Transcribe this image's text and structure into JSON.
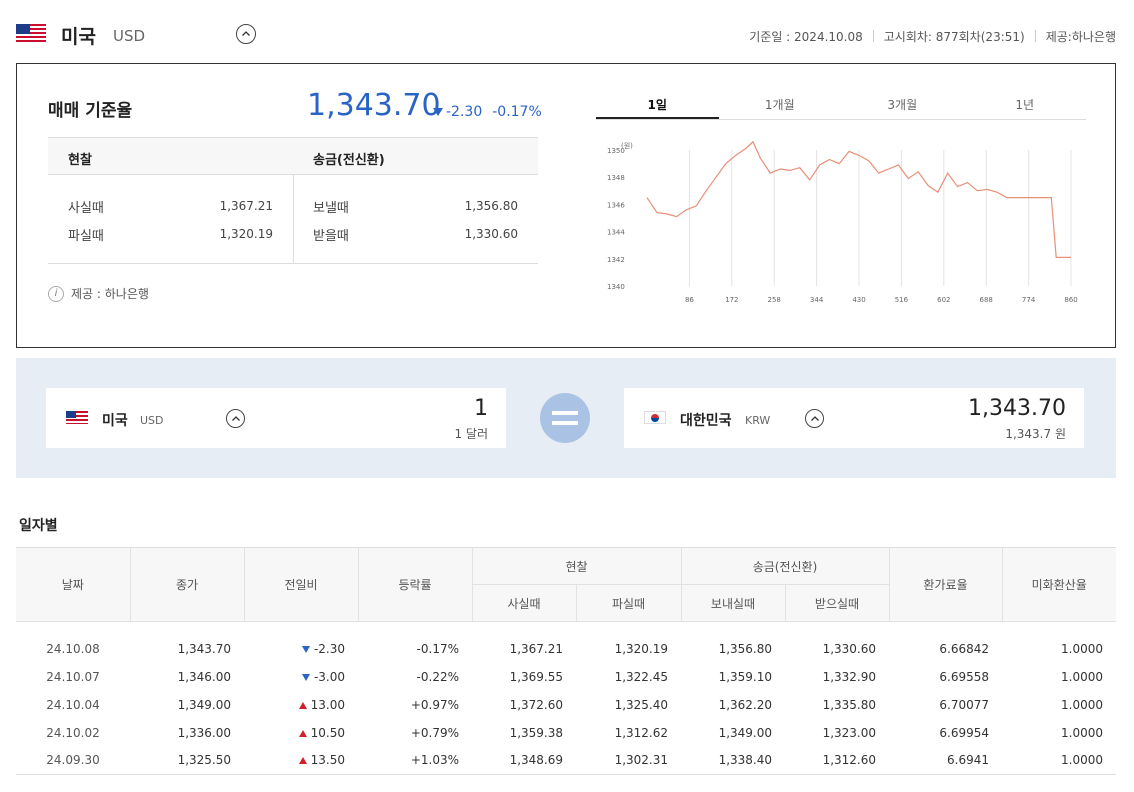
{
  "header": {
    "country": "미국",
    "code": "USD",
    "base_date": "기준일 : 2024.10.08",
    "notice": "고시회차: 877회차(23:51)",
    "provider": "제공:하나은행"
  },
  "summary": {
    "label": "매매 기준율",
    "rate": "1,343.70",
    "change": "-2.30",
    "change_pct": "-0.17%",
    "cash_header": "현찰",
    "wire_header": "송금(전신환)",
    "cash_buy_label": "사실때",
    "cash_buy": "1,367.21",
    "cash_sell_label": "파실때",
    "cash_sell": "1,320.19",
    "wire_send_label": "보낼때",
    "wire_send": "1,356.80",
    "wire_recv_label": "받을때",
    "wire_recv": "1,330.60",
    "provider_note": "제공 : 하나은행"
  },
  "tabs": [
    "1일",
    "1개월",
    "3개월",
    "1년"
  ],
  "chart_data": {
    "type": "line",
    "unit_label": "(원)",
    "x_ticks": [
      86,
      172,
      258,
      344,
      430,
      516,
      602,
      688,
      774,
      860
    ],
    "y_ticks": [
      1340,
      1342,
      1344,
      1346,
      1348,
      1350
    ],
    "xlim": [
      0,
      860
    ],
    "ylim": [
      1340,
      1350
    ],
    "grid": "vertical",
    "color": "#e88f78",
    "series": [
      {
        "x": [
          0,
          20,
          40,
          60,
          80,
          100,
          120,
          140,
          160,
          180,
          200,
          215,
          230,
          250,
          270,
          290,
          310,
          330,
          350,
          370,
          390,
          410,
          430,
          450,
          470,
          490,
          510,
          530,
          550,
          570,
          590,
          610,
          630,
          650,
          670,
          690,
          710,
          730,
          750,
          770,
          780,
          800,
          820,
          830,
          840,
          860
        ],
        "y": [
          1346.5,
          1345.4,
          1345.3,
          1345.1,
          1345.6,
          1345.9,
          1347.0,
          1348.0,
          1349.0,
          1349.6,
          1350.1,
          1350.6,
          1349.4,
          1348.3,
          1348.6,
          1348.5,
          1348.7,
          1347.8,
          1348.9,
          1349.3,
          1349.0,
          1349.9,
          1349.6,
          1349.2,
          1348.3,
          1348.6,
          1348.9,
          1347.9,
          1348.4,
          1347.4,
          1346.9,
          1348.3,
          1347.3,
          1347.6,
          1347.0,
          1347.1,
          1346.9,
          1346.5,
          1346.5,
          1346.5,
          1346.5,
          1346.5,
          1346.5,
          1342.1,
          1342.1,
          1342.1
        ]
      }
    ]
  },
  "converter": {
    "from_country": "미국",
    "from_code": "USD",
    "from_amount": "1",
    "from_sub": "1 달러",
    "to_country": "대한민국",
    "to_code": "KRW",
    "to_amount": "1,343.70",
    "to_sub": "1,343.7 원"
  },
  "daily": {
    "title": "일자별",
    "headers": {
      "date": "날짜",
      "close": "종가",
      "diff": "전일비",
      "pct": "등락률",
      "cash": "현찰",
      "cash_buy": "사실때",
      "cash_sell": "파실때",
      "wire": "송금(전신환)",
      "wire_send": "보내실때",
      "wire_recv": "받으실때",
      "fee": "환가료율",
      "usd_rate": "미화환산율"
    },
    "rows": [
      {
        "date": "24.10.08",
        "close": "1,343.70",
        "dir": "down",
        "diff": "-2.30",
        "pct": "-0.17%",
        "cash_buy": "1,367.21",
        "cash_sell": "1,320.19",
        "wire_send": "1,356.80",
        "wire_recv": "1,330.60",
        "fee": "6.66842",
        "usd_rate": "1.0000"
      },
      {
        "date": "24.10.07",
        "close": "1,346.00",
        "dir": "down",
        "diff": "-3.00",
        "pct": "-0.22%",
        "cash_buy": "1,369.55",
        "cash_sell": "1,322.45",
        "wire_send": "1,359.10",
        "wire_recv": "1,332.90",
        "fee": "6.69558",
        "usd_rate": "1.0000"
      },
      {
        "date": "24.10.04",
        "close": "1,349.00",
        "dir": "up",
        "diff": "13.00",
        "pct": "+0.97%",
        "cash_buy": "1,372.60",
        "cash_sell": "1,325.40",
        "wire_send": "1,362.20",
        "wire_recv": "1,335.80",
        "fee": "6.70077",
        "usd_rate": "1.0000"
      },
      {
        "date": "24.10.02",
        "close": "1,336.00",
        "dir": "up",
        "diff": "10.50",
        "pct": "+0.79%",
        "cash_buy": "1,359.38",
        "cash_sell": "1,312.62",
        "wire_send": "1,349.00",
        "wire_recv": "1,323.00",
        "fee": "6.69954",
        "usd_rate": "1.0000"
      },
      {
        "date": "24.09.30",
        "close": "1,325.50",
        "dir": "up",
        "diff": "13.50",
        "pct": "+1.03%",
        "cash_buy": "1,348.69",
        "cash_sell": "1,302.31",
        "wire_send": "1,338.40",
        "wire_recv": "1,312.60",
        "fee": "6.6941",
        "usd_rate": "1.0000"
      }
    ]
  }
}
